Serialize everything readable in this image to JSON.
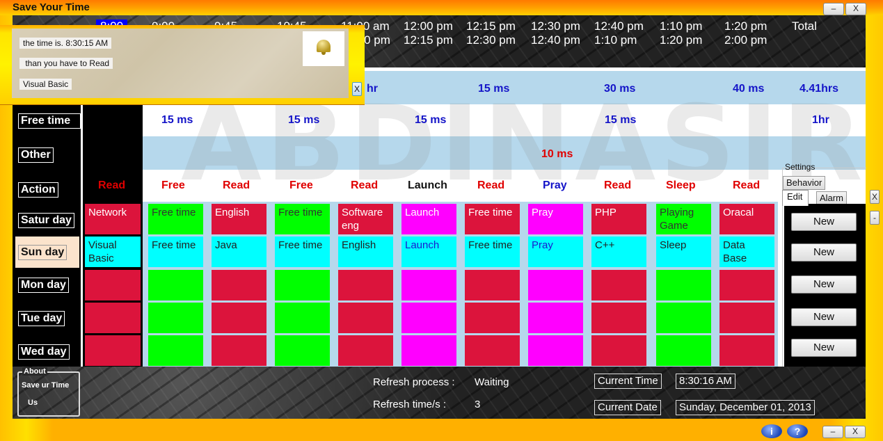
{
  "window": {
    "title": "Save Your Time",
    "minimize_label": "–",
    "close_label": "X"
  },
  "header": {
    "time_columns": [
      {
        "from": "8:00",
        "to": "",
        "highlighted": true
      },
      {
        "from": "9:00",
        "to": ""
      },
      {
        "from": "9:45",
        "to": ""
      },
      {
        "from": "10:45",
        "to": ""
      },
      {
        "from": "11:00 am",
        "to": "12:00 pm"
      },
      {
        "from": "12:00 pm",
        "to": "12:15 pm"
      },
      {
        "from": "12:15 pm",
        "to": "12:30 pm"
      },
      {
        "from": "12:30 pm",
        "to": "12:40 pm"
      },
      {
        "from": "12:40 pm",
        "to": "1:10 pm"
      },
      {
        "from": "1:10 pm",
        "to": "1:20 pm"
      },
      {
        "from": "1:20 pm",
        "to": "2:00 pm"
      },
      {
        "from": "Total",
        "to": ""
      }
    ]
  },
  "durations": {
    "row1": [
      {
        "text": "hr"
      },
      {
        "text": "15 ms"
      },
      {
        "text": "30 ms"
      },
      {
        "text": "40 ms"
      },
      {
        "text": "4.41hrs"
      }
    ],
    "row2": [
      {
        "text": "15 ms"
      },
      {
        "text": "15 ms"
      },
      {
        "text": "15 ms"
      },
      {
        "text": "15 ms"
      },
      {
        "text": "1hr"
      }
    ],
    "row3": [
      {
        "text": "10 ms"
      }
    ]
  },
  "watermark": "ABDINASIR",
  "sidebar": {
    "items": [
      {
        "label": "Free time"
      },
      {
        "label": "Other"
      },
      {
        "label": "Action"
      },
      {
        "label": "Satur day"
      },
      {
        "label": "Sun day",
        "selected": true
      },
      {
        "label": "Mon day"
      },
      {
        "label": "Tue day"
      },
      {
        "label": "Wed day"
      }
    ]
  },
  "actions": [
    "Read",
    "Free",
    "Read",
    "Free",
    "Read",
    "Launch",
    "Read",
    "Pray",
    "Read",
    "Sleep",
    "Read"
  ],
  "schedule": {
    "rows": [
      {
        "day": "Satur day",
        "cells": [
          {
            "text": "Network",
            "color": "red"
          },
          {
            "text": "Free time",
            "color": "green"
          },
          {
            "text": "English",
            "color": "red"
          },
          {
            "text": "Free time",
            "color": "green"
          },
          {
            "text": "Software eng",
            "color": "red"
          },
          {
            "text": "Launch",
            "color": "magenta"
          },
          {
            "text": "Free time",
            "color": "red"
          },
          {
            "text": "Pray",
            "color": "magenta"
          },
          {
            "text": "PHP",
            "color": "red"
          },
          {
            "text": "Playing Game",
            "color": "green"
          },
          {
            "text": "Oracal",
            "color": "red"
          }
        ]
      },
      {
        "day": "Sun day",
        "cells": [
          {
            "text": "Visual Basic",
            "color": "cyan"
          },
          {
            "text": "Free time",
            "color": "cyan"
          },
          {
            "text": "Java",
            "color": "cyan"
          },
          {
            "text": "Free time",
            "color": "cyan"
          },
          {
            "text": "English",
            "color": "cyan"
          },
          {
            "text": "Launch",
            "color": "cyan",
            "blue_text": true
          },
          {
            "text": "Free time",
            "color": "cyan"
          },
          {
            "text": "Pray",
            "color": "cyan",
            "blue_text": true
          },
          {
            "text": "C++",
            "color": "cyan"
          },
          {
            "text": "Sleep",
            "color": "cyan"
          },
          {
            "text": "Data Base",
            "color": "cyan"
          }
        ]
      },
      {
        "day": "Mon day",
        "cells": [
          {
            "text": "",
            "color": "red"
          },
          {
            "text": "",
            "color": "green"
          },
          {
            "text": "",
            "color": "red"
          },
          {
            "text": "",
            "color": "green"
          },
          {
            "text": "",
            "color": "red"
          },
          {
            "text": "",
            "color": "magenta"
          },
          {
            "text": "",
            "color": "red"
          },
          {
            "text": "",
            "color": "magenta"
          },
          {
            "text": "",
            "color": "red"
          },
          {
            "text": "",
            "color": "green"
          },
          {
            "text": "",
            "color": "red"
          }
        ]
      },
      {
        "day": "Tue day",
        "cells": [
          {
            "text": "",
            "color": "red"
          },
          {
            "text": "",
            "color": "green"
          },
          {
            "text": "",
            "color": "red"
          },
          {
            "text": "",
            "color": "green"
          },
          {
            "text": "",
            "color": "red"
          },
          {
            "text": "",
            "color": "magenta"
          },
          {
            "text": "",
            "color": "red"
          },
          {
            "text": "",
            "color": "magenta"
          },
          {
            "text": "",
            "color": "red"
          },
          {
            "text": "",
            "color": "green"
          },
          {
            "text": "",
            "color": "red"
          }
        ]
      },
      {
        "day": "Wed day",
        "cells": [
          {
            "text": "",
            "color": "red"
          },
          {
            "text": "",
            "color": "green"
          },
          {
            "text": "",
            "color": "red"
          },
          {
            "text": "",
            "color": "green"
          },
          {
            "text": "",
            "color": "red"
          },
          {
            "text": "",
            "color": "magenta"
          },
          {
            "text": "",
            "color": "red"
          },
          {
            "text": "",
            "color": "magenta"
          },
          {
            "text": "",
            "color": "red"
          },
          {
            "text": "",
            "color": "green"
          },
          {
            "text": "",
            "color": "red"
          }
        ]
      }
    ]
  },
  "colors": {
    "red": "#dc143c",
    "green": "#00ff00",
    "magenta": "#ff00ff",
    "cyan": "#00ffff",
    "band_blue": "#b6d8ec",
    "duration_blue": "#1414c8",
    "action_red": "#e00000"
  },
  "settings": {
    "legend": "Settings",
    "tabs": [
      {
        "label": "Behavior"
      },
      {
        "label": "Edit",
        "active": true
      },
      {
        "label": "Alarm"
      }
    ],
    "new_buttons": [
      "New",
      "New",
      "New",
      "New",
      "New"
    ],
    "side_close": "X",
    "side_min": "-"
  },
  "popup": {
    "line1": "the time is. 8:30:15 AM",
    "line2": " than you have to Read",
    "line3": "Visual Basic",
    "close_label": "X",
    "icon": "bell-icon"
  },
  "about": {
    "legend": "About",
    "item1": "Save ur Time",
    "item2": "Us"
  },
  "status": {
    "refresh_process_label": "Refresh process :",
    "refresh_process_value": "Waiting",
    "refresh_time_label": "Refresh time/s :",
    "refresh_time_value": "3",
    "current_time_label": "Current Time",
    "current_time_value": "8:30:16 AM",
    "current_date_label": "Current Date",
    "current_date_value": "Sunday, December 01, 2013"
  },
  "bottom_bar": {
    "info_icon": "i",
    "help_icon": "?",
    "minimize_label": "–",
    "close_label": "X"
  }
}
